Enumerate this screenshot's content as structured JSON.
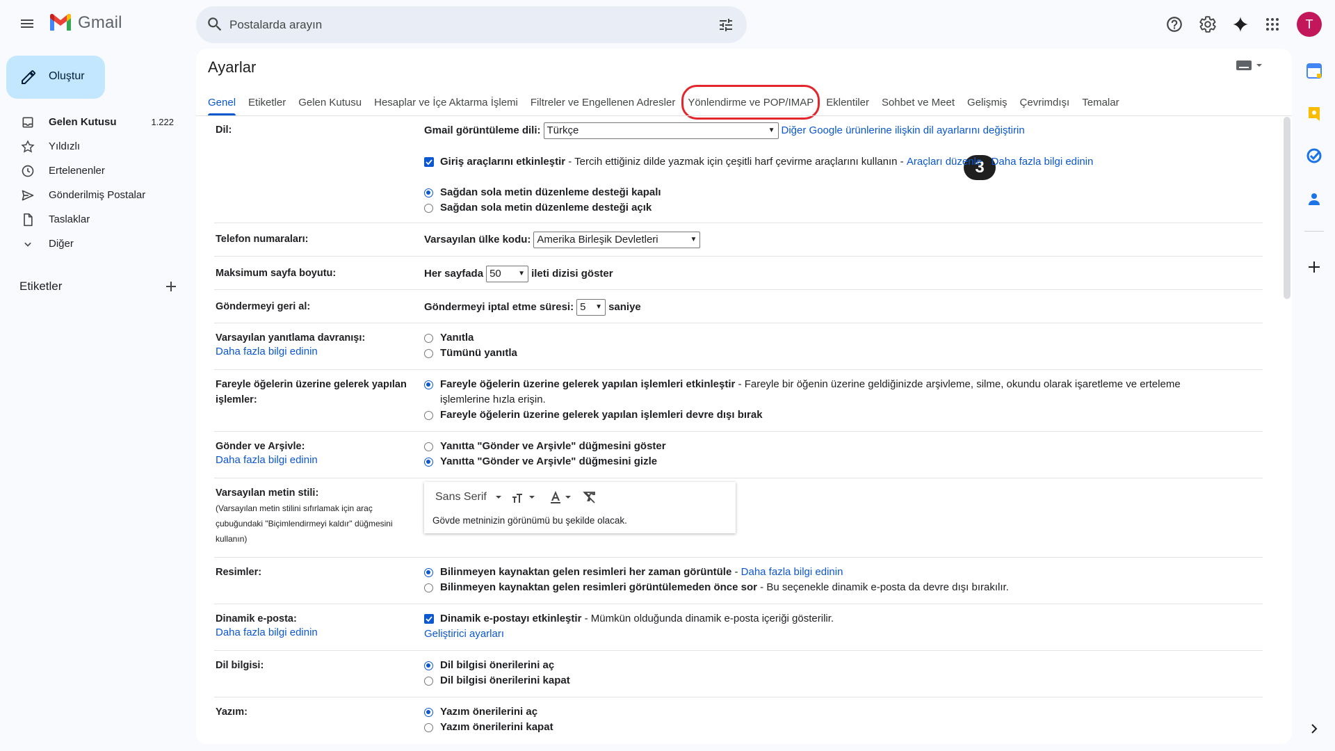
{
  "app": {
    "logo_text": "Gmail"
  },
  "search": {
    "placeholder": "Postalarda arayın"
  },
  "user": {
    "avatar_initial": "T",
    "avatar_color": "#c2185b"
  },
  "compose": {
    "label": "Oluştur"
  },
  "nav": [
    {
      "label": "Gelen Kutusu",
      "count": "1.222",
      "icon": "inbox-icon"
    },
    {
      "label": "Yıldızlı",
      "icon": "star-icon"
    },
    {
      "label": "Ertelenenler",
      "icon": "clock-icon"
    },
    {
      "label": "Gönderilmiş Postalar",
      "icon": "send-icon"
    },
    {
      "label": "Taslaklar",
      "icon": "draft-icon"
    },
    {
      "label": "Diğer",
      "icon": "chevron-down-icon"
    }
  ],
  "labels_header": "Etiketler",
  "settings": {
    "title": "Ayarlar",
    "tabs": [
      "Genel",
      "Etiketler",
      "Gelen Kutusu",
      "Hesaplar ve İçe Aktarma İşlemi",
      "Filtreler ve Engellenen Adresler",
      "Yönlendirme ve POP/IMAP",
      "Eklentiler",
      "Sohbet ve Meet",
      "Gelişmiş",
      "Çevrimdışı",
      "Temalar"
    ],
    "step_badge": "3",
    "language": {
      "label": "Dil:",
      "display_label": "Gmail görüntüleme dili:",
      "display_value": "Türkçe",
      "other_link": "Diğer Google ürünlerine ilişkin dil ayarlarını değiştirin",
      "input_tools_bold": "Giriş araçlarını etkinleştir",
      "input_tools_desc": " - Tercih ettiğiniz dilde yazmak için çeşitli harf çevirme araçlarını kullanın - ",
      "edit_tools_link": "Araçları düzenle",
      "sep": " - ",
      "learn_more": "Daha fazla bilgi edinin",
      "rtl_off": "Sağdan sola metin düzenleme desteği kapalı",
      "rtl_on": "Sağdan sola metin düzenleme desteği açık"
    },
    "phone": {
      "label": "Telefon numaraları:",
      "country_label": "Varsayılan ülke kodu:",
      "country_value": "Amerika Birleşik Devletleri"
    },
    "page_size": {
      "label": "Maksimum sayfa boyutu:",
      "prefix": "Her sayfada",
      "value": "50",
      "suffix": "ileti dizisi göster"
    },
    "undo_send": {
      "label": "Göndermeyi geri al:",
      "prefix": "Göndermeyi iptal etme süresi:",
      "value": "5",
      "suffix": "saniye"
    },
    "reply": {
      "label": "Varsayılan yanıtlama davranışı:",
      "learn_more": "Daha fazla bilgi edinin",
      "opt1": "Yanıtla",
      "opt2": "Tümünü yanıtla"
    },
    "hover": {
      "label_line1": "Fareyle öğelerin üzerine gelerek yapılan",
      "label_line2": "işlemler:",
      "opt1_bold": "Fareyle öğelerin üzerine gelerek yapılan işlemleri etkinleştir",
      "opt1_desc": " - Fareyle bir öğenin üzerine geldiğinizde arşivleme, silme, okundu olarak işaretleme ve erteleme",
      "opt1_desc2": "işlemlerine hızla erişin.",
      "opt2": "Fareyle öğelerin üzerine gelerek yapılan işlemleri devre dışı bırak"
    },
    "send_archive": {
      "label": "Gönder ve Arşivle:",
      "learn_more": "Daha fazla bilgi edinin",
      "opt1": "Yanıtta \"Gönder ve Arşivle\" düğmesini göster",
      "opt2": "Yanıtta \"Gönder ve Arşivle\" düğmesini gizle"
    },
    "text_style": {
      "label": "Varsayılan metin stili:",
      "sub1": "(Varsayılan metin stilini sıfırlamak için araç",
      "sub2": "çubuğundaki \"Biçimlendirmeyi kaldır\" düğmesini",
      "sub3": "kullanın)",
      "font_name": "Sans Serif",
      "sample": "Gövde metninizin görünümü bu şekilde olacak."
    },
    "images": {
      "label": "Resimler:",
      "opt1_bold": "Bilinmeyen kaynaktan gelen resimleri her zaman görüntüle",
      "opt1_sep": " - ",
      "learn_more": "Daha fazla bilgi edinin",
      "opt2_bold": "Bilinmeyen kaynaktan gelen resimleri görüntülemeden önce sor",
      "opt2_desc": " - Bu seçenekle dinamik e-posta da devre dışı bırakılır."
    },
    "dynamic": {
      "label": "Dinamik e-posta:",
      "learn_more": "Daha fazla bilgi edinin",
      "opt_bold": "Dinamik e-postayı etkinleştir",
      "opt_desc": " - Mümkün olduğunda dinamik e-posta içeriği gösterilir.",
      "dev_link": "Geliştirici ayarları"
    },
    "grammar": {
      "label": "Dil bilgisi:",
      "opt1": "Dil bilgisi önerilerini aç",
      "opt2": "Dil bilgisi önerilerini kapat"
    },
    "spelling": {
      "label": "Yazım:",
      "opt1": "Yazım önerilerini aç",
      "opt2": "Yazım önerilerini kapat"
    }
  },
  "colors": {
    "accent": "#0b57d0",
    "highlight": "#e3262c",
    "compose_bg": "#c2e7ff"
  }
}
